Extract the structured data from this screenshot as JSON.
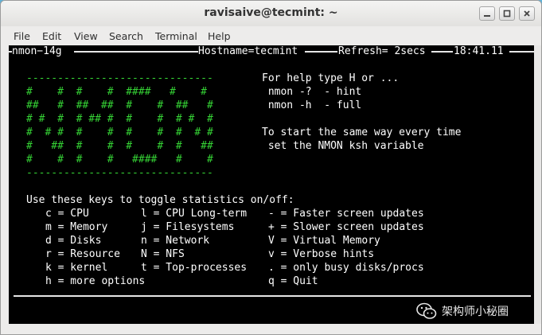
{
  "window": {
    "title": "ravisaive@tecmint: ~",
    "controls": [
      "minimize-icon",
      "maximize-icon",
      "close-icon"
    ]
  },
  "menu": [
    "File",
    "Edit",
    "View",
    "Search",
    "Terminal",
    "Help"
  ],
  "nmon_header": {
    "version": "nmon−14g",
    "hostname": "Hostname=tecmint",
    "refresh": "Refresh= 2secs",
    "time": "18:41.11"
  },
  "logo": {
    "dashes": "------------------------------",
    "rows": [
      "#    #  #    #  ####   #    #",
      "##   #  ##  ##  #    #  ##   #",
      "# #  #  # ## #  #    #  # #  #",
      "#  # #  #    #  #    #  #  # #",
      "#   ##  #    #  #    #  #   ##",
      "#    #  #    #   ####   #    #"
    ]
  },
  "help": [
    "For help type H or ...",
    " nmon -?  - hint",
    " nmon -h  - full",
    "",
    "To start the same way every time",
    " set the NMON ksh variable"
  ],
  "keys": {
    "intro": "Use these keys to toggle statistics on/off:",
    "rows": [
      [
        "c = CPU",
        "l = CPU Long-term",
        "- = Faster screen updates"
      ],
      [
        "m = Memory",
        "j = Filesystems",
        "+ = Slower screen updates"
      ],
      [
        "d = Disks",
        "n = Network",
        "V = Virtual Memory"
      ],
      [
        "r = Resource",
        "N = NFS",
        "v = Verbose hints"
      ],
      [
        "k = kernel",
        "t = Top-processes",
        ". = only busy disks/procs"
      ],
      [
        "h = more options",
        "",
        "q = Quit"
      ]
    ]
  },
  "watermark": "架构师小秘圈",
  "colors": {
    "terminal_bg": "#000000",
    "terminal_fg": "#ffffff",
    "logo_green": "#35d335",
    "desktop_blue": "#5fb3d9"
  }
}
